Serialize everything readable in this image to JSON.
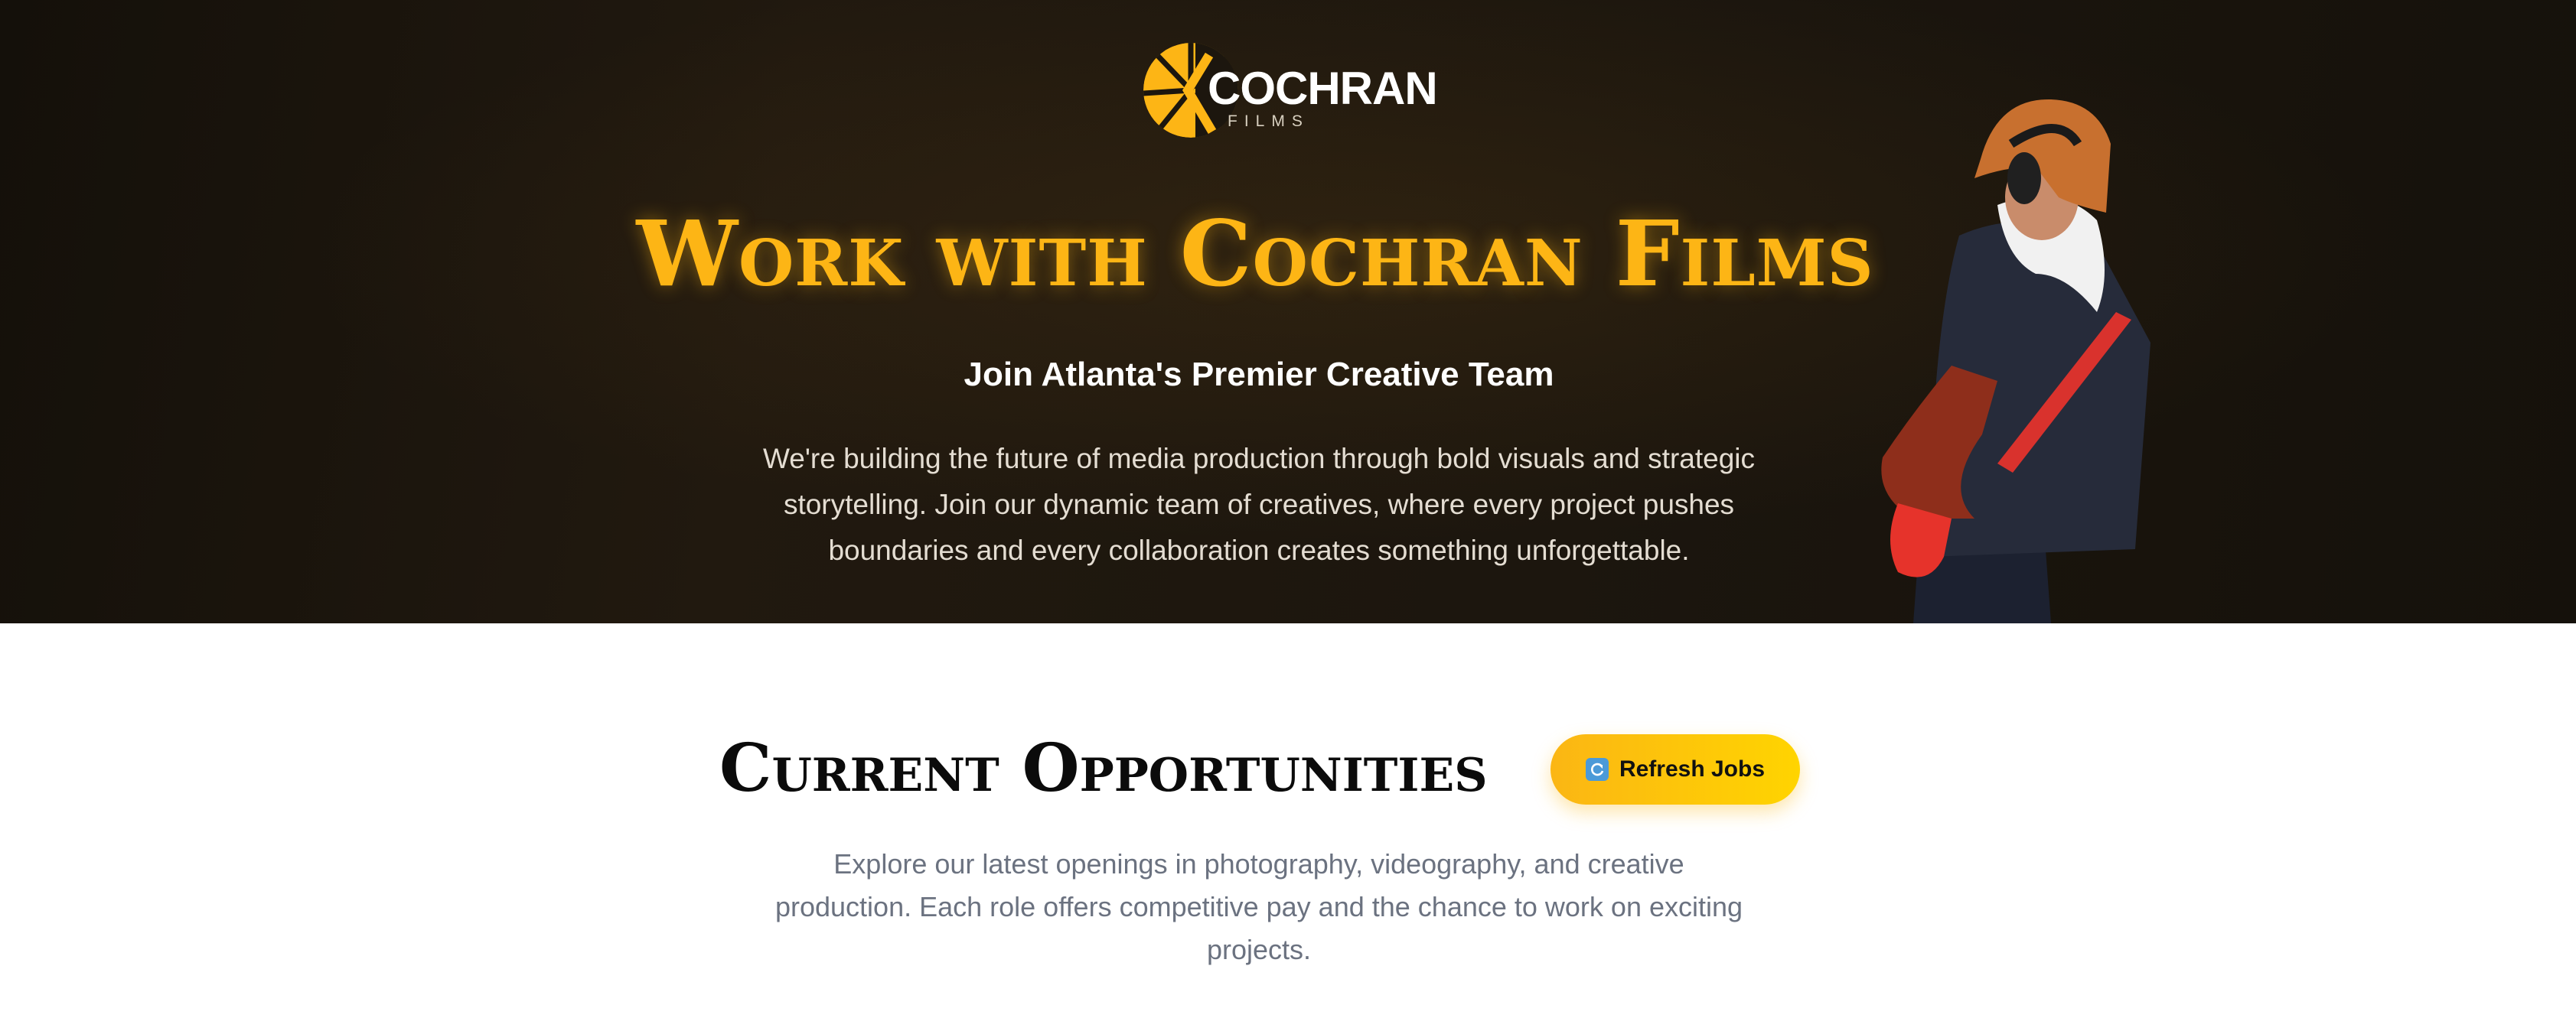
{
  "logo": {
    "name": "COCHRAN",
    "subtitle": "FILMS"
  },
  "hero": {
    "title": "Work with Cochran Films",
    "subtitle": "Join Atlanta's Premier Creative Team",
    "description": "We're building the future of media production through bold visuals and strategic storytelling. Join our dynamic team of creatives, where every project pushes boundaries and every collaboration creates something unforgettable."
  },
  "opportunities": {
    "title": "Current Opportunities",
    "refresh_label": "Refresh Jobs",
    "refresh_icon": "refresh-icon",
    "description": "Explore our latest openings in photography, videography, and creative production. Each role offers competitive pay and the chance to work on exciting projects."
  },
  "colors": {
    "accent": "#fdb515",
    "hero_bg": "#1c160e",
    "button_end": "#ffd400",
    "muted_text": "#6b7280"
  }
}
